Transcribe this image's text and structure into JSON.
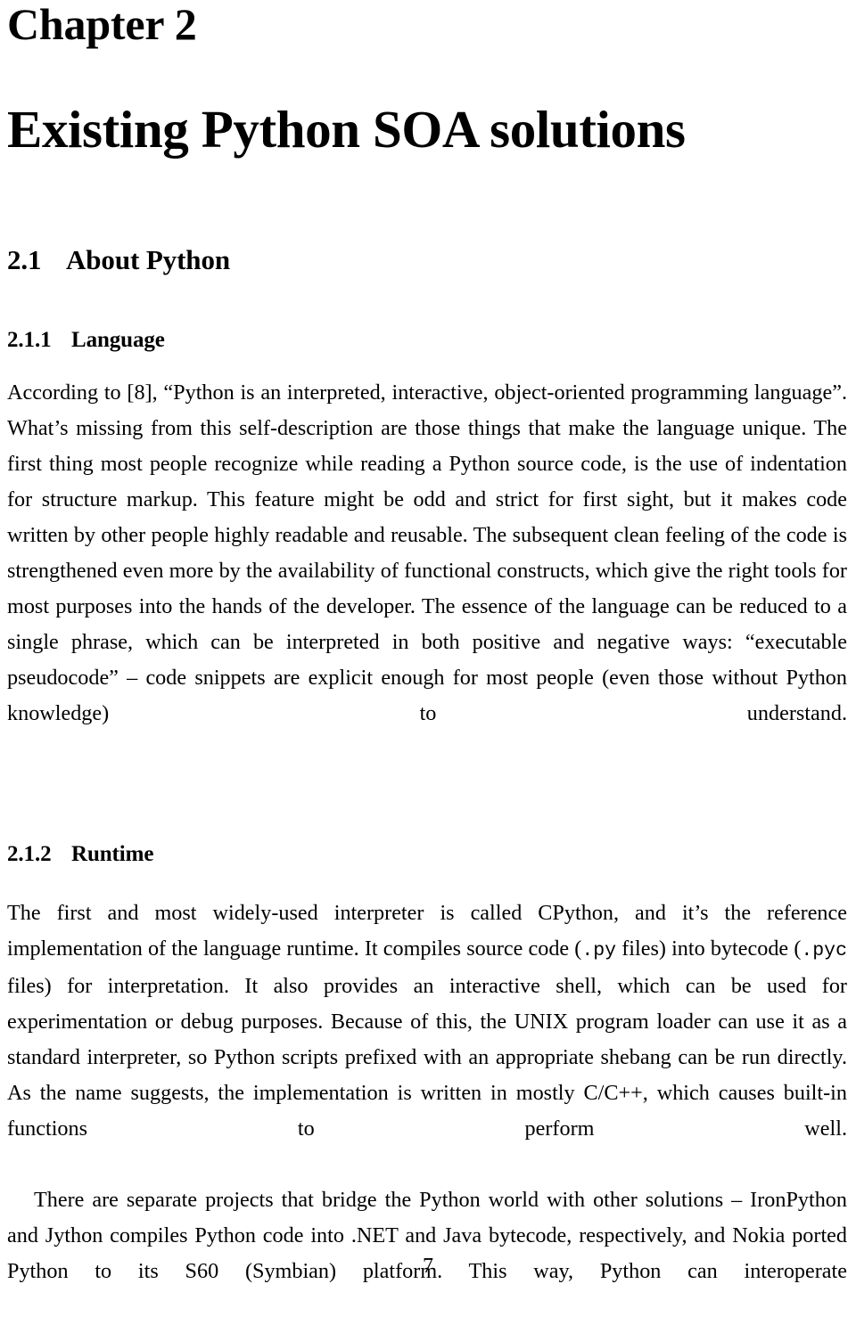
{
  "document": {
    "chapter_label": "Chapter 2",
    "chapter_title": "Existing Python SOA solutions",
    "page_number": "7"
  },
  "sections": {
    "about_python": {
      "number": "2.1",
      "title": "About Python"
    },
    "language": {
      "number": "2.1.1",
      "title": "Language",
      "paragraph": "According to [8], “Python is an interpreted, interactive, object-oriented programming language”. What’s missing from this self-description are those things that make the language unique. The first thing most people recognize while reading a Python source code, is the use of indentation for structure markup. This feature might be odd and strict for first sight, but it makes code written by other people highly readable and reusable. The subsequent clean feeling of the code is strengthened even more by the availability of functional constructs, which give the right tools for most purposes into the hands of the developer. The essence of the language can be reduced to a single phrase, which can be interpreted in both positive and negative ways: “executable pseudocode” – code snippets are explicit enough for most people (even those without Python knowledge) to understand."
    },
    "runtime": {
      "number": "2.1.2",
      "title": "Runtime",
      "paragraph_1_part_1": "The first and most widely-used interpreter is called CPython, and it’s the reference implementation of the language runtime. It compiles source code (",
      "paragraph_1_code_1": ".py",
      "paragraph_1_part_2": " files) into bytecode (",
      "paragraph_1_code_2": ".pyc",
      "paragraph_1_part_3": " files) for interpretation. It also provides an interactive shell, which can be used for experimentation or debug purposes. Because of this, the UNIX program loader can use it as a standard interpreter, so Python scripts prefixed with an appropriate shebang can be run directly. As the name suggests, the implementation is written in mostly C/C++, which causes built-in functions to perform well.",
      "paragraph_2": "There are separate projects that bridge the Python world with other solutions – IronPython and Jython compiles Python code into .NET and Java bytecode, respectively, and Nokia ported Python to its S60 (Symbian) platform. This way, Python can interoperate"
    }
  }
}
